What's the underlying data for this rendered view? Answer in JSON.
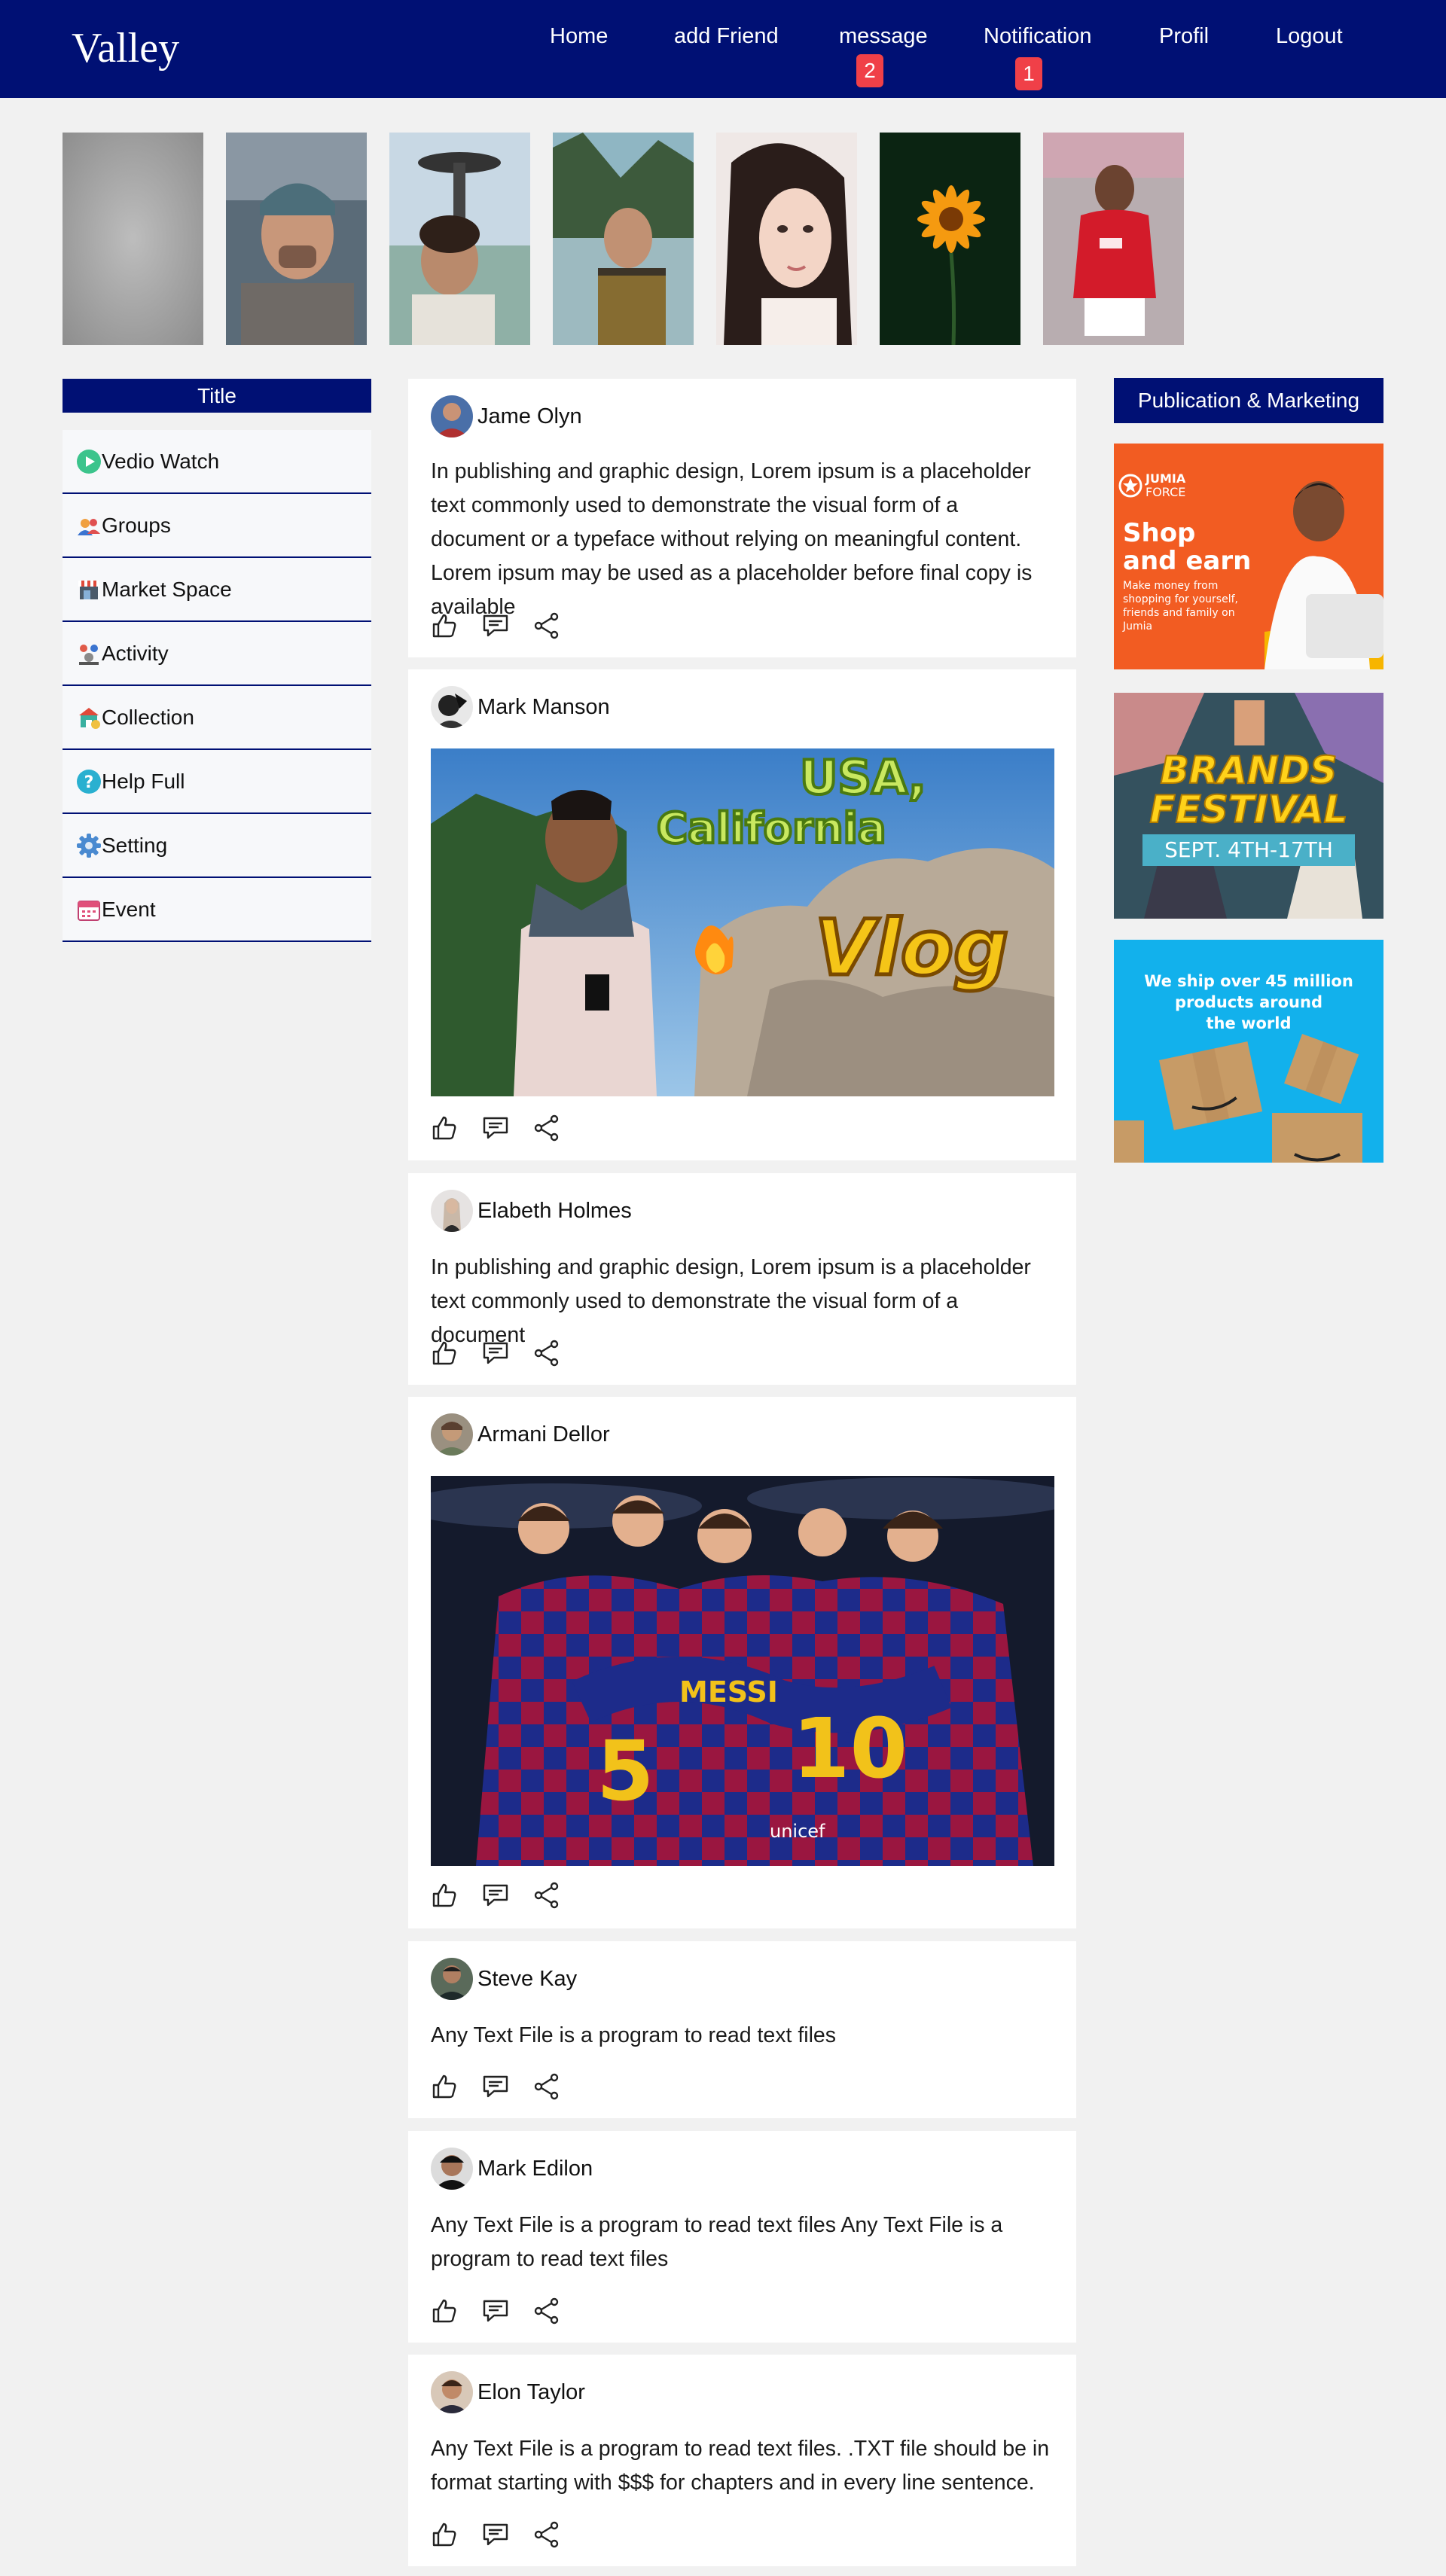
{
  "app": {
    "brand": "Valley"
  },
  "nav": {
    "home": "Home",
    "add_friend": "add Friend",
    "message": "message",
    "message_badge": "2",
    "notification": "Notification",
    "notification_badge": "1",
    "profil": "Profil",
    "logout": "Logout"
  },
  "stories": [
    "story-blank",
    "story-man-cap",
    "story-man-fountain",
    "story-man-lake",
    "story-woman",
    "story-flower",
    "story-footballer"
  ],
  "sidebar": {
    "title": "Title",
    "items": [
      {
        "label": "Vedio Watch",
        "icon": "play-icon"
      },
      {
        "label": "Groups",
        "icon": "groups-icon"
      },
      {
        "label": "Market Space",
        "icon": "market-icon"
      },
      {
        "label": "Activity",
        "icon": "activity-icon"
      },
      {
        "label": "Collection",
        "icon": "collection-icon"
      },
      {
        "label": "Help Full",
        "icon": "help-icon"
      },
      {
        "label": "Setting",
        "icon": "gear-icon"
      },
      {
        "label": "Event",
        "icon": "calendar-icon"
      }
    ]
  },
  "posts": [
    {
      "author": "Jame Olyn",
      "text": "In publishing and graphic design, Lorem ipsum is a placeholder text commonly used to demonstrate the visual form of a document or a typeface without relying on meaningful content. Lorem ipsum may be used as a placeholder before final copy is available"
    },
    {
      "author": "Mark Manson",
      "media": {
        "line1": "USA,",
        "line2": "California",
        "line3": "Vlog"
      }
    },
    {
      "author": "Elabeth Holmes",
      "text": "In publishing and graphic design, Lorem ipsum is a placeholder text commonly used to demonstrate the visual form of a document"
    },
    {
      "author": "Armani Dellor",
      "media": {
        "shirt_text": "MESSI",
        "number": "10",
        "sponsor": "unicef"
      }
    },
    {
      "author": "Steve Kay",
      "text": "Any Text File is a program to read text files"
    },
    {
      "author": "Mark Edilon",
      "text": "Any Text File is a program to read text files Any Text File is a program to read text files"
    },
    {
      "author": "Elon Taylor",
      "text": "Any Text File is a program to read text files. .TXT file should be in format starting with $$$ for chapters and in every line sentence."
    }
  ],
  "ads": {
    "title": "Publication & Marketing",
    "jumia": {
      "brand_line1": "JUMIA",
      "brand_line2": "FORCE",
      "headline1": "Shop",
      "headline2": "and earn",
      "sub1": "Make money from",
      "sub2": "shopping for yourself,",
      "sub3": "friends and family on",
      "sub4": "Jumia"
    },
    "festival": {
      "line1": "BRANDS",
      "line2": "FESTIVAL",
      "dates": "SEPT. 4TH-17TH"
    },
    "amazon": {
      "line1": "We ship over 45 million",
      "line2": "products around",
      "line3": "the world"
    }
  },
  "colors": {
    "navy": "#001074",
    "badge": "#f04048",
    "background": "#f1f1f1"
  }
}
